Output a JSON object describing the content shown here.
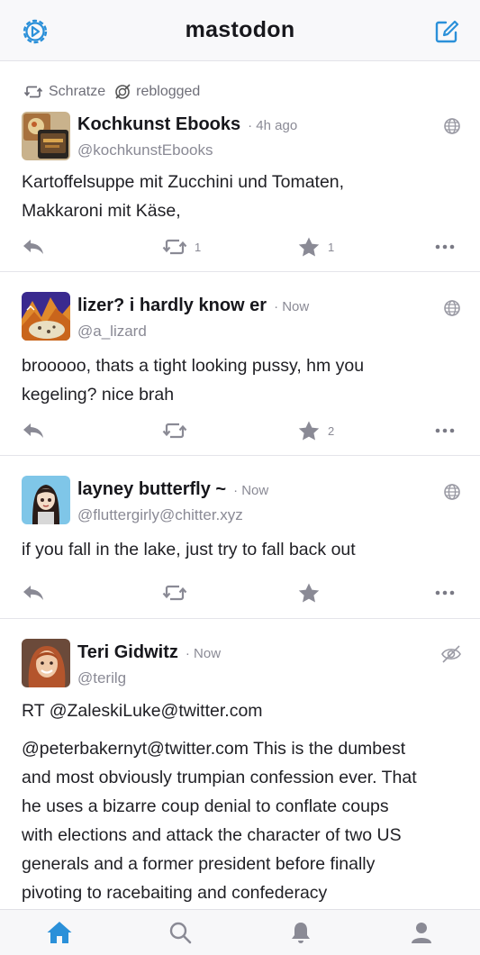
{
  "header": {
    "title": "mastodon",
    "left_icon": "settings-icon",
    "right_icon": "compose-icon",
    "accent": "#2b90d9"
  },
  "statuses": [
    {
      "reblog": {
        "by": "Schratze",
        "label": "reblogged"
      },
      "name": "Kochkunst Ebooks",
      "time": "· 4h ago",
      "handle": "@kochkunstEbooks",
      "visibility_icon": "globe-icon",
      "content": [
        "Kartoffelsuppe mit Zucchini und Tomaten,",
        "Makkaroni mit Käse,"
      ],
      "reply_count": "",
      "boost_count": "1",
      "fav_count": "1"
    },
    {
      "name": "lizer? i hardly know er",
      "time": "· Now",
      "handle": "@a_lizard",
      "visibility_icon": "globe-icon",
      "content": [
        "brooooo, thats a tight looking pussy, hm you",
        "kegeling? nice brah"
      ],
      "boost_count": "",
      "fav_count": "2"
    },
    {
      "name": "layney butterfly ~",
      "time": "· Now",
      "handle": "@fluttergirly@chitter.xyz",
      "visibility_icon": "globe-icon",
      "content": [
        "if you fall in the lake, just try to fall back out"
      ],
      "boost_count": "",
      "fav_count": ""
    },
    {
      "name": "Teri Gidwitz",
      "time": "· Now",
      "handle": "@terilg",
      "visibility_icon": "eye-icon",
      "content_para1": "RT @ZaleskiLuke@twitter.com",
      "content": [
        "@peterbakernyt@twitter.com This is the dumbest",
        "and most obviously trumpian confession ever. That",
        "he uses a bizarre coup denial to conflate coups",
        "with elections and attack the character of two US",
        "generals and a former president before finally",
        "pivoting to racebaiting and confederacy"
      ]
    }
  ],
  "tabs": [
    {
      "icon": "home-icon",
      "active": true
    },
    {
      "icon": "search-icon",
      "active": false
    },
    {
      "icon": "notifications-icon",
      "active": false
    },
    {
      "icon": "profile-icon",
      "active": false
    }
  ]
}
